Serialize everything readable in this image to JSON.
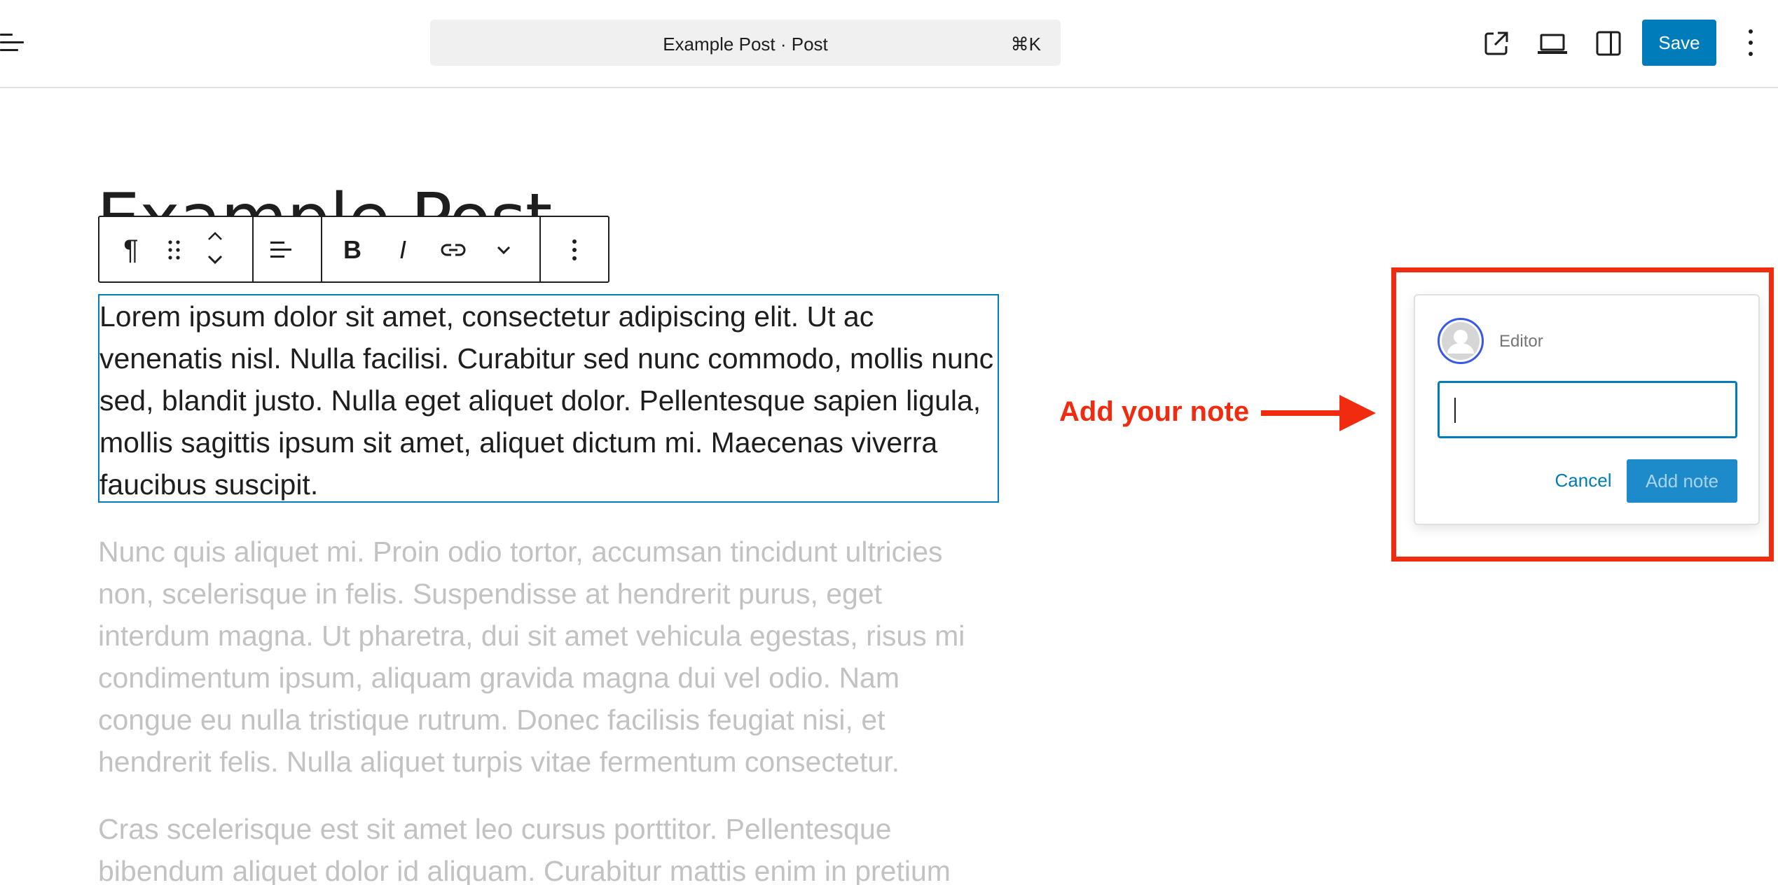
{
  "header": {
    "document_title": "Example Post · Post",
    "shortcut": "⌘K",
    "save_label": "Save",
    "icons": [
      "document-overview-icon",
      "view-post-icon",
      "device-preview-icon",
      "settings-sidebar-icon",
      "options-icon"
    ]
  },
  "editor": {
    "post_title": "Example Post",
    "block_toolbar": {
      "block_type_glyph": "¶",
      "bold_glyph": "B",
      "italic_glyph": "I",
      "items": [
        "paragraph-icon",
        "drag-handle-icon",
        "move-up-icon",
        "move-down-icon",
        "align-icon",
        "bold-icon",
        "italic-icon",
        "link-icon",
        "more-rich-text-icon",
        "block-options-icon"
      ]
    },
    "paragraphs": [
      "Lorem ipsum dolor sit amet, consectetur adipiscing elit. Ut ac venenatis nisl. Nulla facilisi. Curabitur sed nunc commodo, mollis nunc sed, blandit justo. Nulla eget aliquet dolor. Pellentesque sapien ligula, mollis sagittis ipsum sit amet, aliquet dictum mi. Maecenas viverra faucibus suscipit.",
      "Nunc quis aliquet mi. Proin odio tortor, accumsan tincidunt ultricies non, scelerisque in felis. Suspendisse at hendrerit purus, eget interdum magna. Ut pharetra, dui sit amet vehicula egestas, risus mi condimentum ipsum, aliquam gravida magna dui vel odio. Nam congue eu nulla tristique rutrum. Donec facilisis feugiat nisi, et hendrerit felis. Nulla aliquet turpis vitae fermentum consectetur.",
      "Cras scelerisque est sit amet leo cursus porttitor. Pellentesque bibendum aliquet dolor id aliquam. Curabitur mattis enim in pretium"
    ]
  },
  "annotation": {
    "label": "Add your note",
    "color": "#f12b10"
  },
  "note_popover": {
    "author": "Editor",
    "input_value": "",
    "cancel_label": "Cancel",
    "add_label": "Add note"
  },
  "colors": {
    "accent": "#007cba",
    "avatar_ring": "#3858e9",
    "faded_text": "#c2c2c2"
  }
}
